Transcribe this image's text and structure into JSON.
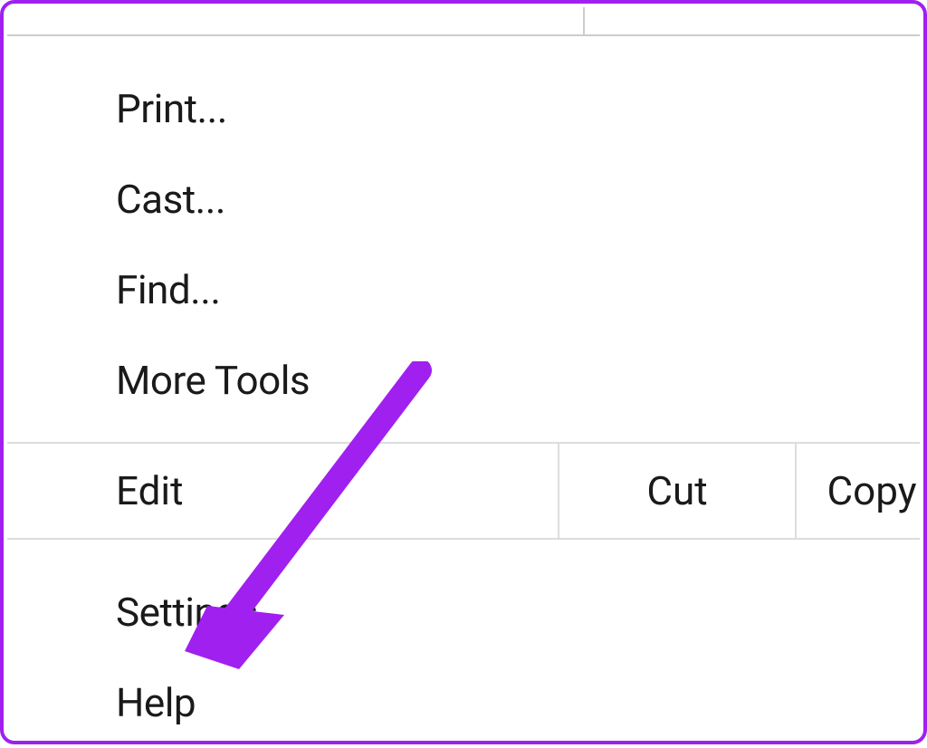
{
  "menu": {
    "print": "Print...",
    "cast": "Cast...",
    "find": "Find...",
    "moreTools": "More Tools",
    "edit": {
      "label": "Edit",
      "cut": "Cut",
      "copy": "Copy"
    },
    "settings": "Settings",
    "help": "Help"
  },
  "annotation": {
    "arrowColor": "#a020f0"
  }
}
